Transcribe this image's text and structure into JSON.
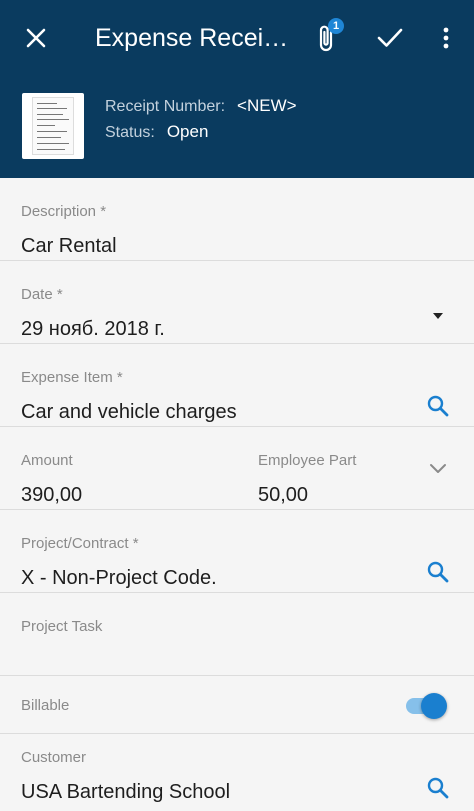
{
  "header": {
    "title": "Expense Recei…",
    "attachment_count": "1",
    "receipt_number_label": "Receipt Number:",
    "receipt_number_value": "<NEW>",
    "status_label": "Status:",
    "status_value": "Open"
  },
  "icons": {
    "close": "close-icon",
    "attach": "paperclip-icon",
    "save": "check-icon",
    "menu": "more-vertical-icon",
    "lookup": "search-icon",
    "dropdown": "caret-down-icon",
    "expand": "chevron-down-icon"
  },
  "colors": {
    "header_bg": "#0a3b5f",
    "accent": "#1a7fcf",
    "badge": "#1f86d6"
  },
  "form": {
    "description": {
      "label": "Description *",
      "value": "Car Rental"
    },
    "date": {
      "label": "Date *",
      "value": "29 нояб. 2018 г."
    },
    "expense_item": {
      "label": "Expense Item *",
      "value": "Car and vehicle charges"
    },
    "amount": {
      "label": "Amount",
      "value": "390,00"
    },
    "employee_part": {
      "label": "Employee Part",
      "value": "50,00"
    },
    "project": {
      "label": "Project/Contract *",
      "value": "X - Non-Project Code."
    },
    "project_task": {
      "label": "Project Task",
      "value": ""
    },
    "billable": {
      "label": "Billable",
      "on": true
    },
    "customer": {
      "label": "Customer",
      "value": "USA Bartending School"
    }
  }
}
